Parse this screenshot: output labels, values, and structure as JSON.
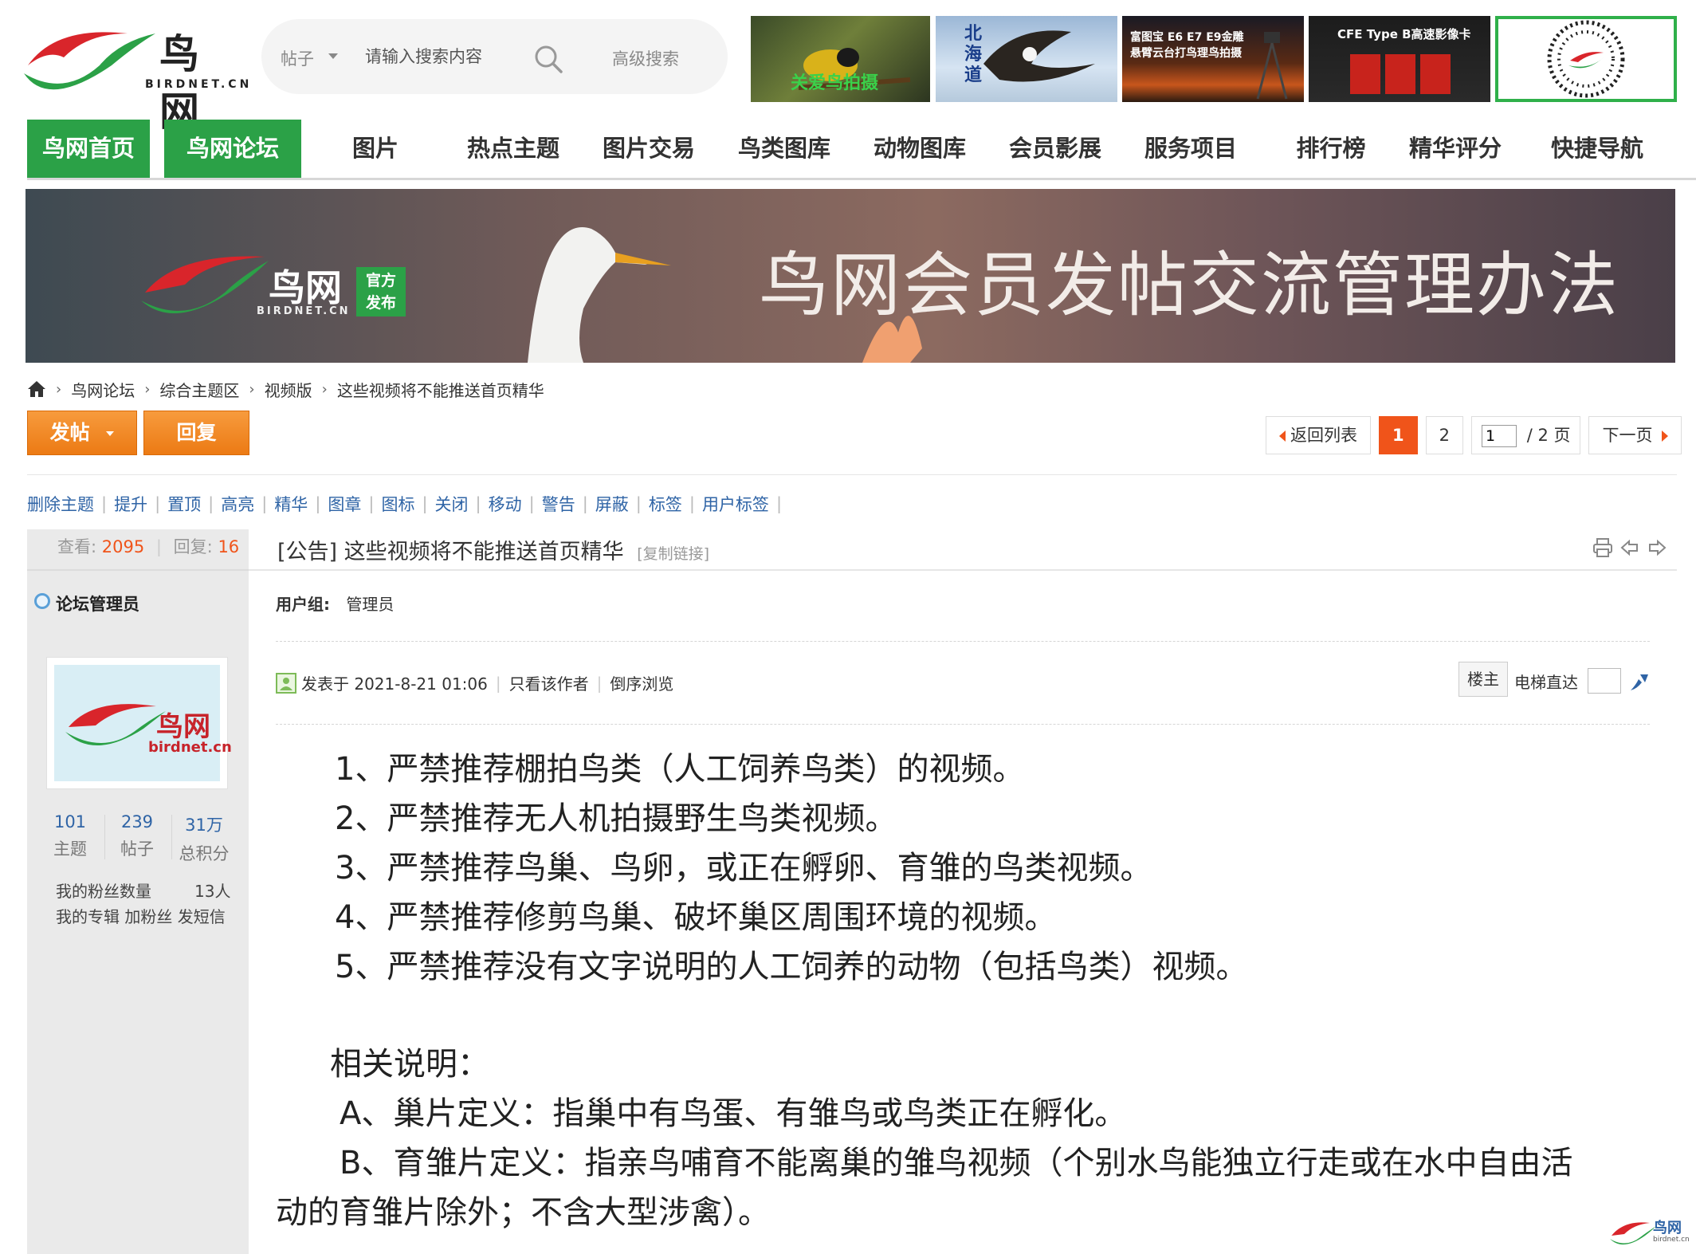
{
  "header": {
    "logo_cn": "鸟网",
    "logo_en": "BIRDNET.CN",
    "search": {
      "type_label": "帖子",
      "placeholder": "请输入搜索内容",
      "advanced_label": "高级搜索"
    },
    "ads": [
      {
        "text": "关爱鸟拍摄"
      },
      {
        "text": "北海道"
      },
      {
        "text_line1": "富图宝 E6 E7 E9金雕",
        "text_line2": "悬臂云台打鸟理鸟拍摄"
      },
      {
        "text_line1": "CFE Type B高速影像卡"
      },
      {
        "text": ""
      }
    ]
  },
  "nav": {
    "items": [
      "鸟网首页",
      "鸟网论坛",
      "图片",
      "热点主题",
      "图片交易",
      "鸟类图库",
      "动物图库",
      "会员影展",
      "服务项目",
      "排行榜",
      "精华评分",
      "快捷导航"
    ]
  },
  "banner": {
    "logo_cn": "鸟网",
    "logo_en": "BIRDNET.CN",
    "badge_line1": "官方",
    "badge_line2": "发布",
    "title": "鸟网会员发帖交流管理办法"
  },
  "breadcrumb": [
    "鸟网论坛",
    "综合主题区",
    "视频版",
    "这些视频将不能推送首页精华"
  ],
  "actions": {
    "post": "发帖",
    "reply": "回复"
  },
  "pager": {
    "back": "返回列表",
    "pages": [
      "1",
      "2"
    ],
    "current_input": "1",
    "total": "/ 2 页",
    "next": "下一页"
  },
  "mod_tools": [
    "删除主题",
    "提升",
    "置顶",
    "高亮",
    "精华",
    "图章",
    "图标",
    "关闭",
    "移动",
    "警告",
    "屏蔽",
    "标签",
    "用户标签"
  ],
  "thread": {
    "views_label": "查看:",
    "views": "2095",
    "replies_label": "回复:",
    "replies": "16",
    "title": "[公告] 这些视频将不能推送首页精华",
    "copy_link": "[复制链接]"
  },
  "author": {
    "name": "论坛管理员",
    "avatar_cn": "鸟网",
    "avatar_en": "birdnet.cn",
    "stats": [
      {
        "num": "101",
        "label": "主题"
      },
      {
        "num": "239",
        "label": "帖子"
      },
      {
        "num": "31万",
        "label": "总积分"
      }
    ],
    "fans_label": "我的粉丝数量",
    "fans_count": "13人",
    "links": "我的专辑 加粉丝 发短信"
  },
  "post": {
    "usergroup_label": "用户组:",
    "usergroup": "管理员",
    "posted": "发表于 2021-8-21 01:06",
    "only_author": "只看该作者",
    "reverse": "倒序浏览",
    "floor": "楼主",
    "elevator": "电梯直达",
    "rules": [
      "1、严禁推荐棚拍鸟类（人工饲养鸟类）的视频。",
      "2、严禁推荐无人机拍摄野生鸟类视频。",
      "3、严禁推荐鸟巢、鸟卵，或正在孵卵、育雏的鸟类视频。",
      "4、严禁推荐修剪鸟巢、破坏巢区周围环境的视频。",
      "5、严禁推荐没有文字说明的人工饲养的动物（包括鸟类）视频。"
    ],
    "explain_heading": "相关说明：",
    "explain_a": "A、巢片定义：指巢中有鸟蛋、有雏鸟或鸟类正在孵化。",
    "explain_b1": "B、育雏片定义：指亲鸟哺育不能离巢的雏鸟视频（个别水鸟能独立行走或在水中自由活",
    "explain_b2": "动的育雏片除外；不含大型涉禽）。"
  },
  "watermark": {
    "cn": "鸟网",
    "en": "birdnet.cn"
  },
  "colors": {
    "green": "#2ba147",
    "orange": "#ec7a14",
    "red": "#f0541a",
    "link": "#2f64a6"
  }
}
